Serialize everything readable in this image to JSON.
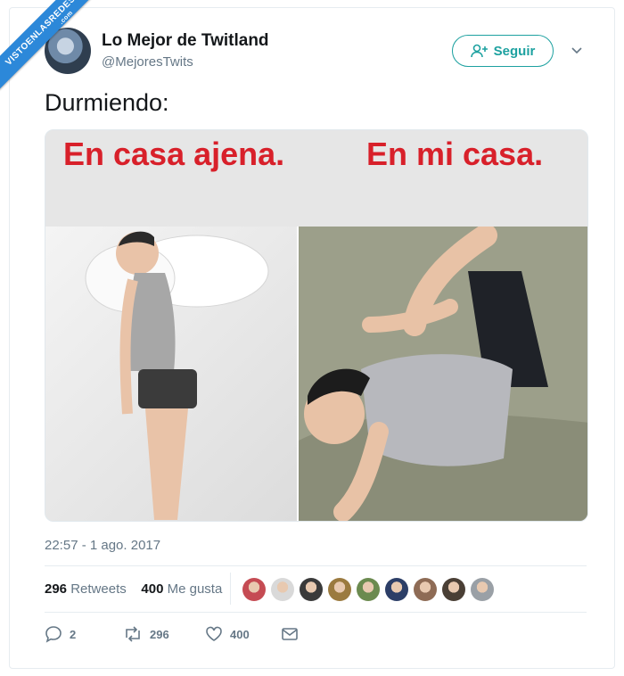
{
  "watermark": {
    "main": "VISTOENLASREDES",
    "sub": ".com"
  },
  "author": {
    "name": "Lo Mejor de Twitland",
    "handle": "@MejoresTwits"
  },
  "follow_button": {
    "label": "Seguir",
    "icon": "add-user-icon"
  },
  "tweet": {
    "text": "Durmiendo:",
    "image": {
      "left_caption": "En casa ajena.",
      "right_caption": "En mi casa."
    },
    "timestamp": "22:57 - 1 ago. 2017"
  },
  "stats": {
    "retweets_count": "296",
    "retweets_label": "Retweets",
    "likes_count": "400",
    "likes_label": "Me gusta",
    "liker_avatar_colors": [
      "#c54b53",
      "#d9d9d9",
      "#3a3a3a",
      "#9b7a3f",
      "#6b8a4f",
      "#2c3e67",
      "#8e6b55",
      "#4a3f35",
      "#9aa0a6"
    ]
  },
  "actions": {
    "reply": {
      "count": "2",
      "icon": "reply-icon"
    },
    "retweet": {
      "count": "296",
      "icon": "retweet-icon"
    },
    "like": {
      "count": "400",
      "icon": "heart-icon"
    },
    "dm": {
      "icon": "envelope-icon"
    }
  },
  "colors": {
    "accent": "#1da1a0",
    "caption_red": "#d8202a",
    "muted": "#657786"
  }
}
